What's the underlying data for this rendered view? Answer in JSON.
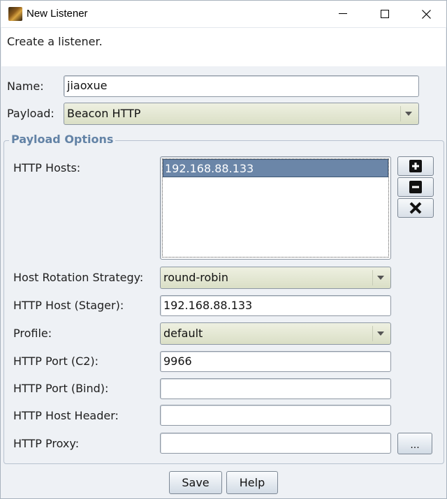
{
  "window": {
    "title": "New Listener"
  },
  "banner": {
    "text": "Create a listener."
  },
  "form": {
    "name_label": "Name:",
    "name_value": "jiaoxue",
    "payload_label": "Payload:",
    "payload_value": "Beacon HTTP"
  },
  "payload_options": {
    "title": "Payload Options",
    "http_hosts_label": "HTTP Hosts:",
    "http_hosts": [
      "192.168.88.133"
    ],
    "rotation_label": "Host Rotation Strategy:",
    "rotation_value": "round-robin",
    "stager_host_label": "HTTP Host (Stager):",
    "stager_host_value": "192.168.88.133",
    "profile_label": "Profile:",
    "profile_value": "default",
    "port_c2_label": "HTTP Port (C2):",
    "port_c2_value": "9966",
    "port_bind_label": "HTTP Port (Bind):",
    "port_bind_value": "",
    "host_header_label": "HTTP Host Header:",
    "host_header_value": "",
    "proxy_label": "HTTP Proxy:",
    "proxy_value": "",
    "proxy_button": "..."
  },
  "actions": {
    "save": "Save",
    "help": "Help"
  },
  "icons": {
    "app": "app-icon",
    "minimize": "minimize-icon",
    "maximize": "maximize-icon",
    "close": "close-icon",
    "add": "plus-icon",
    "remove": "minus-icon",
    "clear": "x-icon",
    "dropdown": "chevron-down-icon"
  },
  "colors": {
    "selection": "#6b86a8",
    "group_title": "#6383a6",
    "combo": "#dadfc6"
  }
}
